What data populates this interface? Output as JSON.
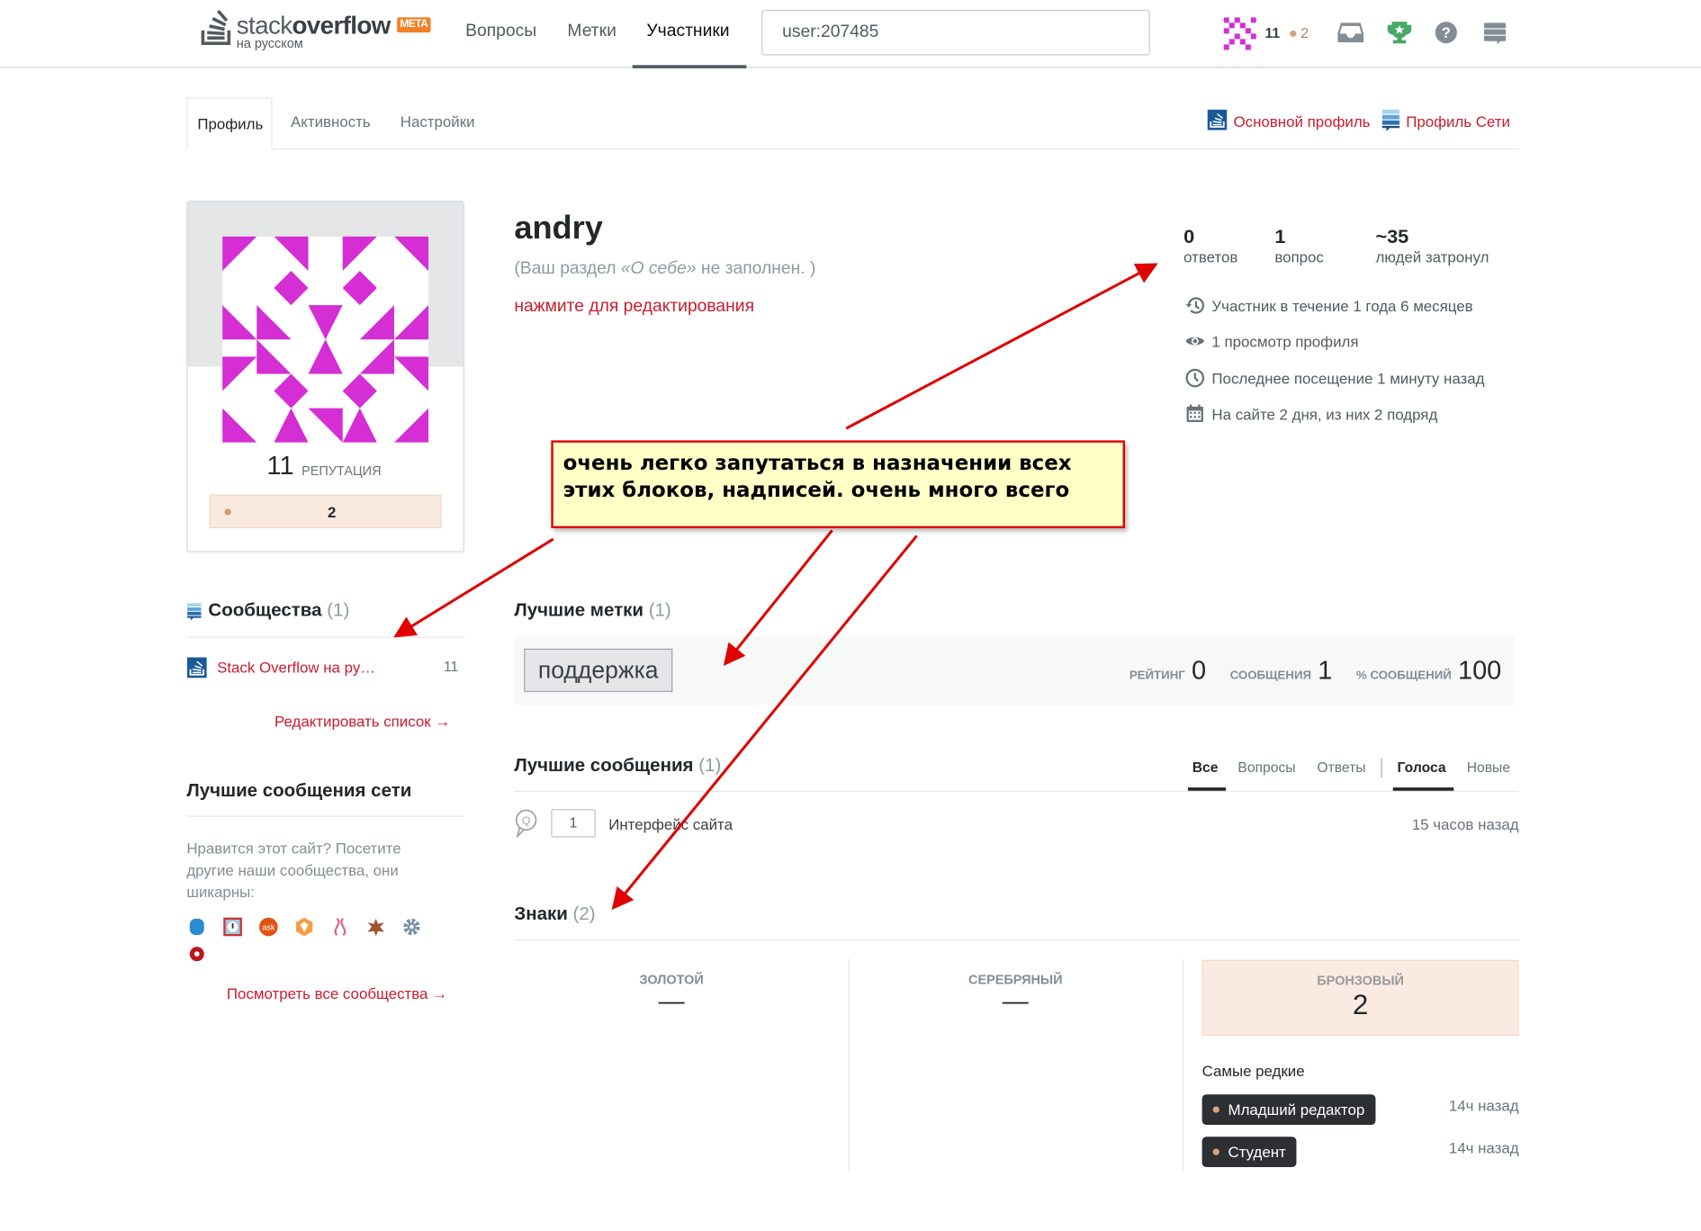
{
  "header": {
    "logo_text_light": "stack",
    "logo_text_bold": "overflow",
    "logo_meta": "META",
    "logo_sub": "на русском",
    "nav": [
      "Вопросы",
      "Метки",
      "Участники"
    ],
    "active_nav": "Участники",
    "search_value": "user:207485",
    "reputation": "11",
    "bronze_count": "2",
    "colors": {
      "accent": "#f48024",
      "bronze": "#d1a684",
      "link": "#c91d2e"
    }
  },
  "tabs": {
    "items": [
      "Профиль",
      "Активность",
      "Настройки"
    ],
    "active": "Профиль",
    "main_profile": "Основной профиль",
    "network_profile": "Профиль Сети"
  },
  "profile": {
    "name": "andry",
    "about_prefix": "(Ваш раздел ",
    "about_em": "«О себе»",
    "about_suffix": " не заполнен. )",
    "edit_link": "нажмите для редактирования",
    "reputation": "11",
    "reputation_label": "РЕПУТАЦИЯ",
    "bronze": "2",
    "stats": [
      {
        "value": "0",
        "label": "ответов"
      },
      {
        "value": "1",
        "label": "вопрос"
      },
      {
        "value": "~35",
        "label": "людей затронул"
      }
    ],
    "info": [
      {
        "icon": "history-icon",
        "text": "Участник в течение 1 года 6 месяцев"
      },
      {
        "icon": "eye-icon",
        "text": "1 просмотр профиля"
      },
      {
        "icon": "clock-icon",
        "text": "Последнее посещение 1 минуту назад"
      },
      {
        "icon": "calendar-icon",
        "text": "На сайте 2 дня, из них 2 подряд"
      }
    ]
  },
  "communities": {
    "title": "Сообщества",
    "count": "(1)",
    "items": [
      {
        "name": "Stack Overflow на ру…",
        "rep": "11"
      }
    ],
    "edit_link": "Редактировать список →"
  },
  "network_posts": {
    "title": "Лучшие сообщения сети",
    "text": "Нравится этот сайт? Посетите другие наши сообщества, они шикарны:",
    "site_icons": [
      "database-icon",
      "alert-icon",
      "ask-icon",
      "box-icon",
      "dna-icon",
      "star-icon",
      "gear-icon",
      "flower-icon"
    ],
    "all_link": "Посмотреть все сообщества →"
  },
  "top_tags": {
    "title": "Лучшие метки",
    "count": "(1)",
    "tag": "поддержка",
    "score_label": "РЕЙТИНГ",
    "score": "0",
    "posts_label": "СООБЩЕНИЯ",
    "posts": "1",
    "percent_label": "% СООБЩЕНИЙ",
    "percent": "100"
  },
  "top_posts": {
    "title": "Лучшие сообщения",
    "count": "(1)",
    "filters": [
      "Все",
      "Вопросы",
      "Ответы"
    ],
    "sorts": [
      "Голоса",
      "Новые"
    ],
    "post": {
      "votes": "1",
      "title": "Интерфейс сайта",
      "time": "15 часов назад"
    }
  },
  "badges": {
    "title": "Знаки",
    "count": "(2)",
    "gold_label": "ЗОЛОТОЙ",
    "gold": "—",
    "silver_label": "СЕРЕБРЯНЫЙ",
    "silver": "—",
    "bronze_label": "БРОНЗОВЫЙ",
    "bronze": "2",
    "rarest_title": "Самые редкие",
    "rarest": [
      {
        "name": "Младший редактор",
        "time": "14ч назад"
      },
      {
        "name": "Студент",
        "time": "14ч назад"
      }
    ]
  },
  "annotation": {
    "text": "очень легко запутаться в назначении всех этих блоков, надписей. очень много всего",
    "color": "#e00000"
  }
}
